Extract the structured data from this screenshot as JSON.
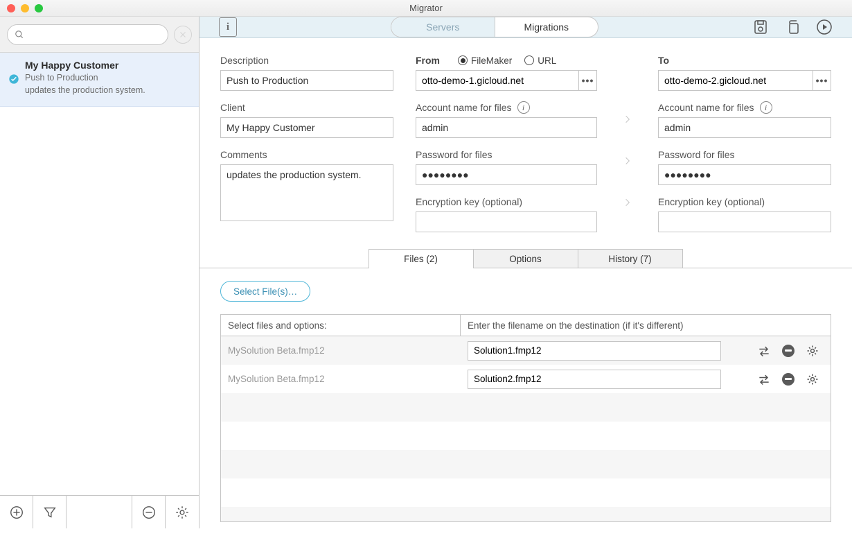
{
  "window": {
    "title": "Migrator"
  },
  "sidebar": {
    "item": {
      "title": "My Happy Customer",
      "line1": "Push to Production",
      "line2": "updates the production system."
    }
  },
  "topbar": {
    "seg_servers": "Servers",
    "seg_migrations": "Migrations"
  },
  "form": {
    "description_label": "Description",
    "description_value": "Push to Production",
    "client_label": "Client",
    "client_value": "My Happy Customer",
    "comments_label": "Comments",
    "comments_value": "updates the production system.",
    "from_label": "From",
    "radio_filemaker": "FileMaker",
    "radio_url": "URL",
    "from_host": "otto-demo-1.gicloud.net",
    "to_label": "To",
    "to_host": "otto-demo-2.gicloud.net",
    "account_label": "Account name for files",
    "from_account": "admin",
    "to_account": "admin",
    "password_label": "Password for files",
    "from_password": "●●●●●●●●",
    "to_password": "●●●●●●●●",
    "enc_label": "Encryption key (optional)"
  },
  "tabs": {
    "files": "Files (2)",
    "options": "Options",
    "history": "History (7)"
  },
  "files": {
    "select_btn": "Select File(s)…",
    "header_left": "Select files and options:",
    "header_right": "Enter the filename on the destination (if it's different)",
    "rows": [
      {
        "source": "MySolution Beta.fmp12",
        "dest": "Solution1.fmp12"
      },
      {
        "source": "MySolution Beta.fmp12",
        "dest": "Solution2.fmp12"
      }
    ]
  }
}
